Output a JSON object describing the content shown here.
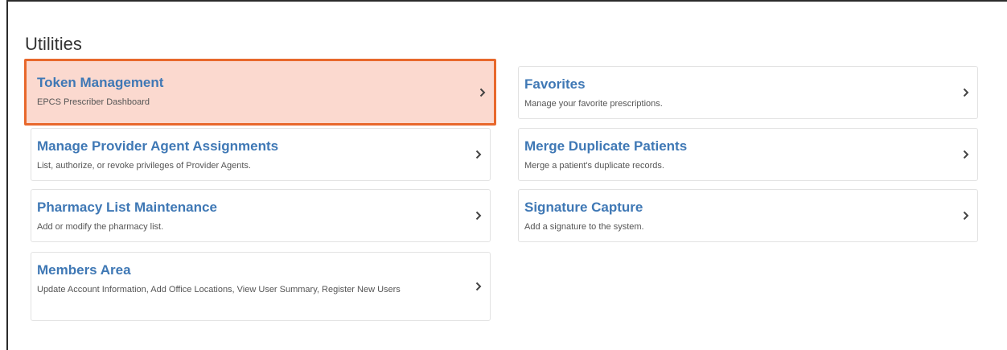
{
  "page": {
    "title": "Utilities"
  },
  "left_column": [
    {
      "title": "Token Management",
      "description": "EPCS Prescriber Dashboard",
      "highlighted": true
    },
    {
      "title": "Manage Provider Agent Assignments",
      "description": "List, authorize, or revoke privileges of Provider Agents.",
      "highlighted": false
    },
    {
      "title": "Pharmacy List Maintenance",
      "description": "Add or modify the pharmacy list.",
      "highlighted": false
    },
    {
      "title": "Members Area",
      "description": "Update Account Information, Add Office Locations, View User Summary, Register New Users",
      "highlighted": false
    }
  ],
  "right_column": [
    {
      "title": "Favorites",
      "description": "Manage your favorite prescriptions."
    },
    {
      "title": "Merge Duplicate Patients",
      "description": "Merge a patient's duplicate records."
    },
    {
      "title": "Signature Capture",
      "description": "Add a signature to the system."
    }
  ],
  "icons": {
    "chevron": "chevron-right-icon"
  },
  "colors": {
    "link_blue": "#3f78b5",
    "highlight_fill": "#fbd9cf",
    "highlight_border": "#e8682c"
  }
}
